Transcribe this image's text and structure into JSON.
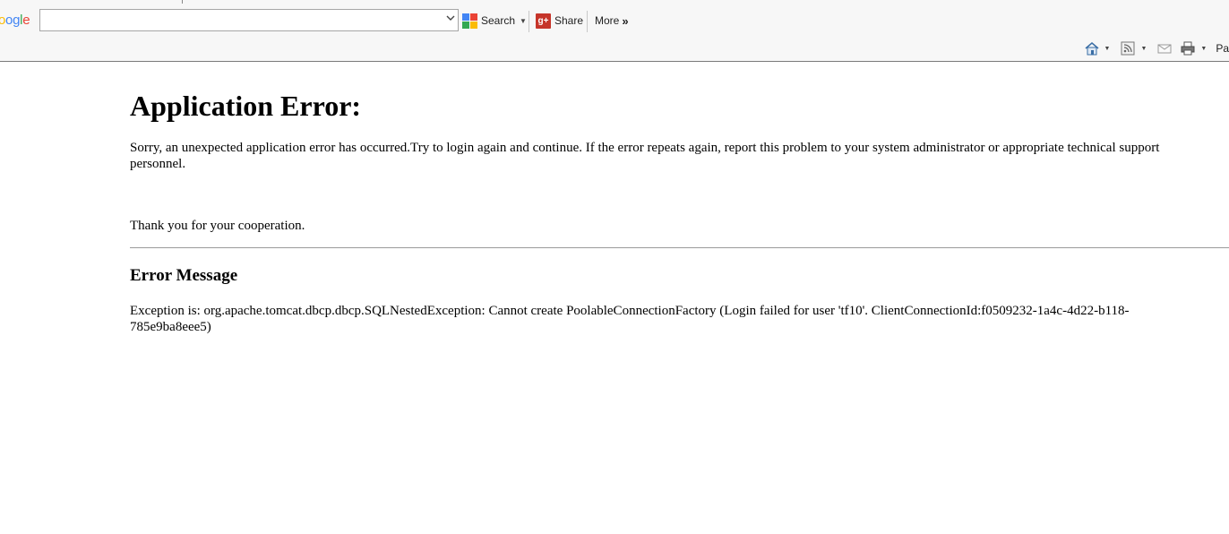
{
  "toolbar": {
    "logo_fragment": "oogle",
    "search_value": "",
    "search_label": "Search",
    "share_label": "Share",
    "more_label": "More",
    "more_icon": "»",
    "page_menu_fragment": "Pa"
  },
  "icons": {
    "home": "home-icon",
    "feeds": "rss-feed-icon",
    "mail": "read-mail-icon",
    "print": "print-icon"
  },
  "page": {
    "title": "Application Error:",
    "intro": "Sorry, an unexpected application error has occurred.Try to login again and continue. If the error repeats again, report this problem to your system administrator or appropriate technical support personnel.",
    "thanks": "Thank you for your cooperation.",
    "error_heading": "Error Message",
    "exception": "Exception is: org.apache.tomcat.dbcp.dbcp.SQLNestedException: Cannot create PoolableConnectionFactory (Login failed for user 'tf10'. ClientConnectionId:f0509232-1a4c-4d22-b118-785e9ba8eee5)"
  },
  "colors": {
    "google_blue": "#4285f4",
    "google_red": "#ea4335",
    "google_yellow": "#fbbc05",
    "google_green": "#34a853",
    "share_red": "#c6352a"
  }
}
